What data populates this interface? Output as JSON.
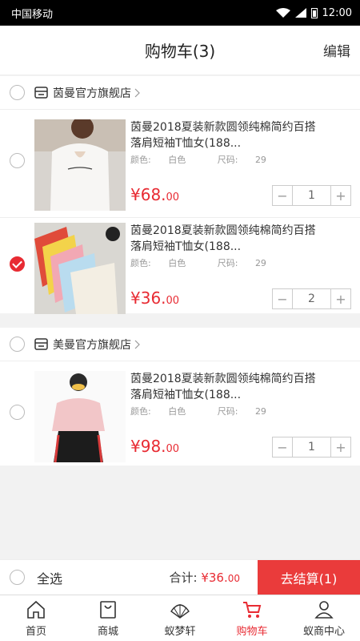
{
  "status": {
    "carrier": "中国移动",
    "time": "12:00"
  },
  "header": {
    "title": "购物车(3)",
    "edit_label": "编辑"
  },
  "stores": [
    {
      "name": "茵曼官方旗舰店",
      "items": [
        {
          "title": "茵曼2018夏装新款圆领纯棉简约百搭落肩短袖T恤女(188...",
          "color_label": "颜色:",
          "color": "白色",
          "size_label": "尺码:",
          "size": "29",
          "price_main": "¥68.",
          "price_dec": "00",
          "qty": "1",
          "checked": false
        },
        {
          "title": "茵曼2018夏装新款圆领纯棉简约百搭落肩短袖T恤女(188...",
          "color_label": "颜色:",
          "color": "白色",
          "size_label": "尺码:",
          "size": "29",
          "price_main": "¥36.",
          "price_dec": "00",
          "qty": "2",
          "checked": true
        }
      ]
    },
    {
      "name": "美曼官方旗舰店",
      "items": [
        {
          "title": "茵曼2018夏装新款圆领纯棉简约百搭落肩短袖T恤女(188...",
          "color_label": "颜色:",
          "color": "白色",
          "size_label": "尺码:",
          "size": "29",
          "price_main": "¥98.",
          "price_dec": "00",
          "qty": "1",
          "checked": false
        }
      ]
    }
  ],
  "stepper": {
    "minus": "−",
    "plus": "+"
  },
  "checkout": {
    "select_all": "全选",
    "total_label": "合计:",
    "total_main": "¥36.",
    "total_dec": "00",
    "pay_label": "去结算(1)"
  },
  "tabs": [
    {
      "label": "首页",
      "icon": "home-icon"
    },
    {
      "label": "商城",
      "icon": "bag-icon"
    },
    {
      "label": "蚁梦轩",
      "icon": "fan-icon"
    },
    {
      "label": "购物车",
      "icon": "cart-icon",
      "active": true
    },
    {
      "label": "蚁商中心",
      "icon": "user-icon"
    }
  ],
  "colors": {
    "accent": "#e82b33"
  }
}
